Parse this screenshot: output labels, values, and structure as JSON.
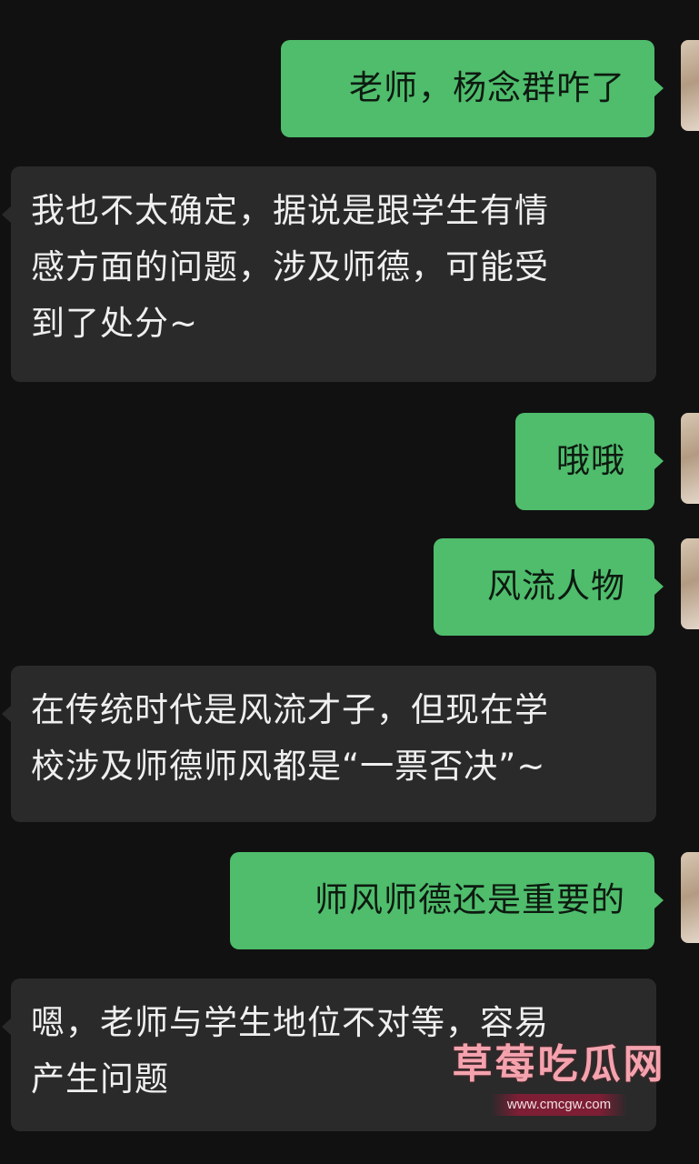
{
  "chat": {
    "messages": [
      {
        "direction": "out",
        "lines": [
          "老师，杨念群咋了"
        ]
      },
      {
        "direction": "in",
        "lines": [
          "我也不太确定，据说是跟学生有情",
          "感方面的问题，涉及师德，可能受",
          "到了处分~"
        ]
      },
      {
        "direction": "out",
        "lines": [
          "哦哦"
        ]
      },
      {
        "direction": "out",
        "lines": [
          "风流人物"
        ]
      },
      {
        "direction": "in",
        "lines": [
          "在传统时代是风流才子，但现在学",
          "校涉及师德师风都是“一票否决”~"
        ]
      },
      {
        "direction": "out",
        "lines": [
          "师风师德还是重要的"
        ]
      },
      {
        "direction": "in",
        "lines": [
          "嗯，老师与学生地位不对等，容易",
          "产生问题"
        ]
      }
    ]
  },
  "watermark": {
    "title": "草莓吃瓜网",
    "url": "www.cmcgw.com"
  },
  "colors": {
    "background": "#111111",
    "outgoing_bubble": "#4fbd6c",
    "incoming_bubble": "#2a2a2a",
    "watermark_text": "#f4a3ae"
  }
}
